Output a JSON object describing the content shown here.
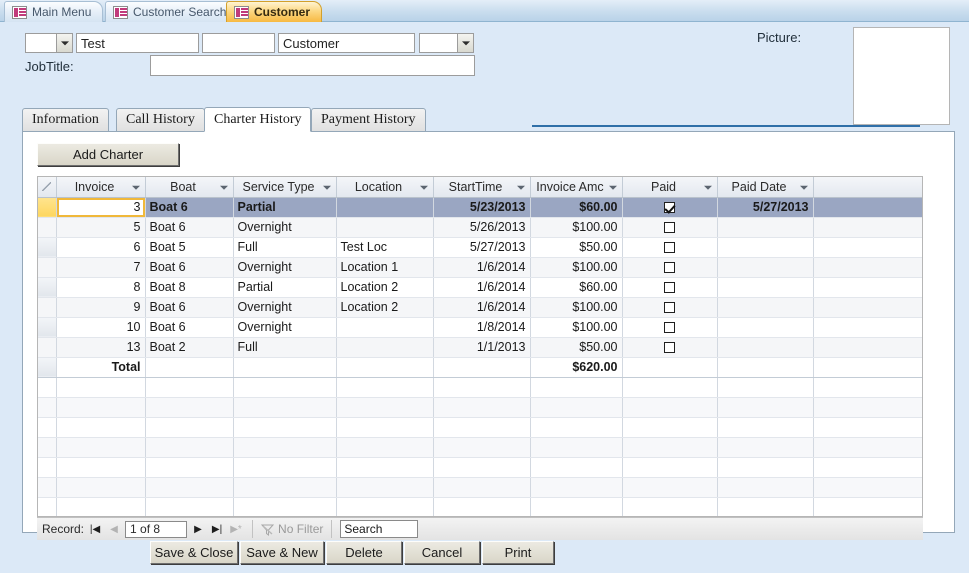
{
  "doc_tabs": [
    {
      "label": "Main Menu",
      "icon": "form-icon",
      "active": false
    },
    {
      "label": "Customer Search",
      "icon": "form-icon",
      "active": false
    },
    {
      "label": "Customer",
      "icon": "form-icon",
      "active": true
    }
  ],
  "header": {
    "salutation_value": "",
    "first_name_value": "Test",
    "middle_value": "",
    "last_name_value": "Customer",
    "suffix_value": "",
    "jobtitle_label": "JobTitle:",
    "jobtitle_value": "",
    "picture_label": "Picture:"
  },
  "tabs": [
    {
      "label": "Information",
      "selected": false
    },
    {
      "label": "Call History",
      "selected": false
    },
    {
      "label": "Charter History",
      "selected": true
    },
    {
      "label": "Payment History",
      "selected": false
    }
  ],
  "add_charter_label": "Add Charter",
  "grid": {
    "columns": [
      {
        "label": "Invoice",
        "sorted": true,
        "align": "right"
      },
      {
        "label": "Boat",
        "sorted": false,
        "align": "left"
      },
      {
        "label": "Service Type",
        "sorted": false,
        "align": "left"
      },
      {
        "label": "Location",
        "sorted": false,
        "align": "left"
      },
      {
        "label": "StartTime",
        "sorted": false,
        "align": "right"
      },
      {
        "label": "Invoice Amc",
        "sorted": false,
        "align": "right"
      },
      {
        "label": "Paid",
        "sorted": false,
        "align": "center"
      },
      {
        "label": "Paid Date",
        "sorted": false,
        "align": "right"
      }
    ],
    "rows": [
      {
        "invoice": "3",
        "boat": "Boat 6",
        "service": "Partial",
        "location": "",
        "start": "5/23/2013",
        "amount": "$60.00",
        "paid": true,
        "paid_date": "5/27/2013",
        "selected": true
      },
      {
        "invoice": "5",
        "boat": "Boat 6",
        "service": "Overnight",
        "location": "",
        "start": "5/26/2013",
        "amount": "$100.00",
        "paid": false,
        "paid_date": "",
        "selected": false
      },
      {
        "invoice": "6",
        "boat": "Boat 5",
        "service": "Full",
        "location": "Test Loc",
        "start": "5/27/2013",
        "amount": "$50.00",
        "paid": false,
        "paid_date": "",
        "selected": false
      },
      {
        "invoice": "7",
        "boat": "Boat 6",
        "service": "Overnight",
        "location": "Location 1",
        "start": "1/6/2014",
        "amount": "$100.00",
        "paid": false,
        "paid_date": "",
        "selected": false
      },
      {
        "invoice": "8",
        "boat": "Boat 8",
        "service": "Partial",
        "location": "Location 2",
        "start": "1/6/2014",
        "amount": "$60.00",
        "paid": false,
        "paid_date": "",
        "selected": false
      },
      {
        "invoice": "9",
        "boat": "Boat 6",
        "service": "Overnight",
        "location": "Location 2",
        "start": "1/6/2014",
        "amount": "$100.00",
        "paid": false,
        "paid_date": "",
        "selected": false
      },
      {
        "invoice": "10",
        "boat": "Boat 6",
        "service": "Overnight",
        "location": "",
        "start": "1/8/2014",
        "amount": "$100.00",
        "paid": false,
        "paid_date": "",
        "selected": false
      },
      {
        "invoice": "13",
        "boat": "Boat 2",
        "service": "Full",
        "location": "",
        "start": "1/1/2013",
        "amount": "$50.00",
        "paid": false,
        "paid_date": "",
        "selected": false
      }
    ],
    "total_label": "Total",
    "total_amount": "$620.00",
    "blank_row_count": 8
  },
  "record_nav": {
    "label": "Record:",
    "first_icon": "first-record-icon",
    "prev_icon": "previous-record-icon",
    "position": "1 of 8",
    "next_icon": "next-record-icon",
    "last_icon": "last-record-icon",
    "new_icon": "new-record-icon",
    "filter_icon": "filter-icon",
    "filter_label": "No Filter",
    "search_placeholder": "Search",
    "search_value": "Search"
  },
  "footer_buttons": [
    {
      "label": "Save & Close"
    },
    {
      "label": "Save & New"
    },
    {
      "label": "Delete"
    },
    {
      "label": "Cancel"
    },
    {
      "label": "Print"
    }
  ],
  "colors": {
    "form_background": "#dce9f7",
    "accent_tab": "#f7b942",
    "sort_header": "#fdd65f",
    "selection": "#9aa6c2",
    "header_rule": "#2f6fa8"
  }
}
